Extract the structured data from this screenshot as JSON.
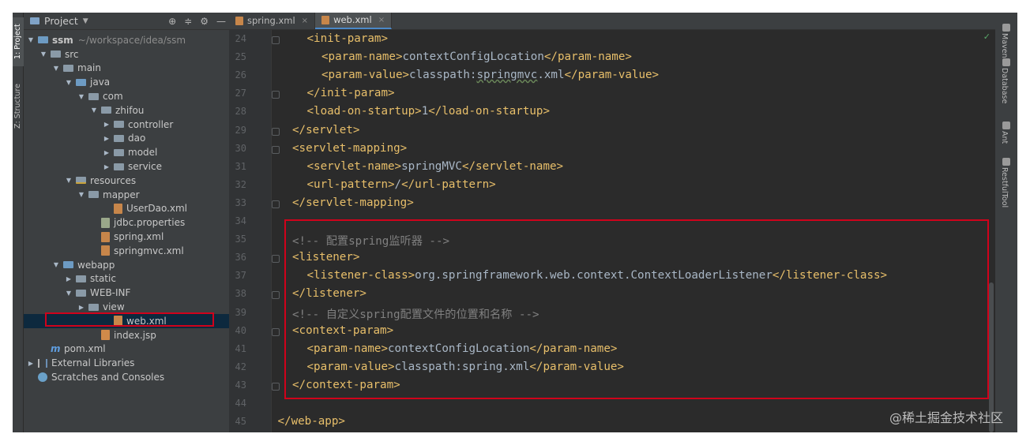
{
  "left_strip": {
    "project_tab": "1: Project",
    "structure_tab": "Z: Structure"
  },
  "project_panel": {
    "title": "Project",
    "tree": [
      {
        "label": "ssm",
        "extra": "~/workspace/idea/ssm",
        "depth": 0,
        "arrow": "▼",
        "icon": "project-folder-icon"
      },
      {
        "label": "src",
        "depth": 1,
        "arrow": "▼",
        "icon": "folder-icon"
      },
      {
        "label": "main",
        "depth": 2,
        "arrow": "▼",
        "icon": "folder-icon"
      },
      {
        "label": "java",
        "depth": 3,
        "arrow": "▼",
        "icon": "source-folder-icon"
      },
      {
        "label": "com",
        "depth": 4,
        "arrow": "▼",
        "icon": "package-icon"
      },
      {
        "label": "zhifou",
        "depth": 5,
        "arrow": "▼",
        "icon": "package-icon"
      },
      {
        "label": "controller",
        "depth": 6,
        "arrow": "▶",
        "icon": "package-icon"
      },
      {
        "label": "dao",
        "depth": 6,
        "arrow": "▶",
        "icon": "package-icon"
      },
      {
        "label": "model",
        "depth": 6,
        "arrow": "▶",
        "icon": "package-icon"
      },
      {
        "label": "service",
        "depth": 6,
        "arrow": "▶",
        "icon": "package-icon"
      },
      {
        "label": "resources",
        "depth": 3,
        "arrow": "▼",
        "icon": "resources-folder-icon"
      },
      {
        "label": "mapper",
        "depth": 4,
        "arrow": "▼",
        "icon": "folder-icon"
      },
      {
        "label": "UserDao.xml",
        "depth": 6,
        "arrow": "",
        "icon": "xml-file-icon"
      },
      {
        "label": "jdbc.properties",
        "depth": 5,
        "arrow": "",
        "icon": "properties-file-icon"
      },
      {
        "label": "spring.xml",
        "depth": 5,
        "arrow": "",
        "icon": "xml-file-icon"
      },
      {
        "label": "springmvc.xml",
        "depth": 5,
        "arrow": "",
        "icon": "xml-file-icon"
      },
      {
        "label": "webapp",
        "depth": 2,
        "arrow": "▼",
        "icon": "web-folder-icon"
      },
      {
        "label": "static",
        "depth": 3,
        "arrow": "▶",
        "icon": "folder-icon"
      },
      {
        "label": "WEB-INF",
        "depth": 3,
        "arrow": "▼",
        "icon": "folder-icon"
      },
      {
        "label": "view",
        "depth": 4,
        "arrow": "▶",
        "icon": "folder-icon"
      },
      {
        "label": "web.xml",
        "depth": 6,
        "arrow": "",
        "icon": "xml-file-icon",
        "selected": true
      },
      {
        "label": "index.jsp",
        "depth": 5,
        "arrow": "",
        "icon": "jsp-file-icon"
      },
      {
        "label": "pom.xml",
        "depth": 1,
        "arrow": "",
        "icon": "maven-icon"
      },
      {
        "label": "External Libraries",
        "depth": 0,
        "arrow": "▶",
        "icon": "libraries-icon"
      },
      {
        "label": "Scratches and Consoles",
        "depth": 0,
        "arrow": "",
        "icon": "scratches-icon"
      }
    ]
  },
  "editor": {
    "tabs": [
      {
        "label": "spring.xml",
        "active": false
      },
      {
        "label": "web.xml",
        "active": true
      }
    ],
    "lines": [
      {
        "num": "24",
        "indent": 1,
        "parts": [
          [
            "tag",
            "<init-param>"
          ]
        ]
      },
      {
        "num": "25",
        "indent": 2,
        "parts": [
          [
            "tag",
            "<param-name>"
          ],
          [
            "txt",
            "contextConfigLocation"
          ],
          [
            "tag",
            "</param-name>"
          ]
        ]
      },
      {
        "num": "26",
        "indent": 2,
        "parts": [
          [
            "tag",
            "<param-value>"
          ],
          [
            "txt",
            "classpath:"
          ],
          [
            "wavy",
            "springmvc"
          ],
          [
            "txt",
            ".xml"
          ],
          [
            "tag",
            "</param-value>"
          ]
        ]
      },
      {
        "num": "27",
        "indent": 1,
        "parts": [
          [
            "tag",
            "</init-param>"
          ]
        ]
      },
      {
        "num": "28",
        "indent": 1,
        "parts": [
          [
            "tag",
            "<load-on-startup>"
          ],
          [
            "txt",
            "1"
          ],
          [
            "tag",
            "</load-on-startup>"
          ]
        ]
      },
      {
        "num": "29",
        "indent": 0,
        "parts": [
          [
            "tag",
            "</servlet>"
          ]
        ]
      },
      {
        "num": "30",
        "indent": 0,
        "parts": [
          [
            "tag",
            "<servlet-mapping>"
          ]
        ]
      },
      {
        "num": "31",
        "indent": 1,
        "parts": [
          [
            "tag",
            "<servlet-name>"
          ],
          [
            "txt",
            "springMVC"
          ],
          [
            "tag",
            "</servlet-name>"
          ]
        ]
      },
      {
        "num": "32",
        "indent": 1,
        "parts": [
          [
            "tag",
            "<url-pattern>"
          ],
          [
            "txt",
            "/"
          ],
          [
            "tag",
            "</url-pattern>"
          ]
        ]
      },
      {
        "num": "33",
        "indent": 0,
        "parts": [
          [
            "tag",
            "</servlet-mapping>"
          ]
        ]
      },
      {
        "num": "34",
        "indent": 0,
        "parts": []
      },
      {
        "num": "35",
        "indent": 0,
        "parts": [
          [
            "cmt",
            "<!-- 配置spring监听器 -->"
          ]
        ]
      },
      {
        "num": "36",
        "indent": 0,
        "parts": [
          [
            "tag",
            "<listener>"
          ]
        ]
      },
      {
        "num": "37",
        "indent": 1,
        "parts": [
          [
            "tag",
            "<listener-class>"
          ],
          [
            "txt",
            "org.springframework.web.context.ContextLoaderListener"
          ],
          [
            "tag",
            "</listener-class>"
          ]
        ]
      },
      {
        "num": "38",
        "indent": 0,
        "parts": [
          [
            "tag",
            "</listener>"
          ]
        ]
      },
      {
        "num": "39",
        "indent": 0,
        "parts": [
          [
            "cmt",
            "<!-- 自定义spring配置文件的位置和名称 -->"
          ]
        ]
      },
      {
        "num": "40",
        "indent": 0,
        "parts": [
          [
            "tag",
            "<context-param>"
          ]
        ]
      },
      {
        "num": "41",
        "indent": 1,
        "parts": [
          [
            "tag",
            "<param-name>"
          ],
          [
            "txt",
            "contextConfigLocation"
          ],
          [
            "tag",
            "</param-name>"
          ]
        ]
      },
      {
        "num": "42",
        "indent": 1,
        "parts": [
          [
            "tag",
            "<param-value>"
          ],
          [
            "txt",
            "classpath:spring.xml"
          ],
          [
            "tag",
            "</param-value>"
          ]
        ]
      },
      {
        "num": "43",
        "indent": 0,
        "parts": [
          [
            "tag",
            "</context-param>"
          ]
        ]
      },
      {
        "num": "44",
        "indent": 0,
        "parts": []
      },
      {
        "num": "45",
        "indent": -1,
        "parts": [
          [
            "tag",
            "</web-app>"
          ]
        ]
      }
    ]
  },
  "right_strip": {
    "tabs": [
      "Maven",
      "Database",
      "Ant",
      "RestfulTool"
    ]
  },
  "watermark": "@稀土掘金技术社区",
  "colors": {
    "highlight": "#d0021b",
    "tag": "#e8bf6a",
    "comment": "#808080",
    "text": "#a9b7c6",
    "background": "#2b2b2b"
  }
}
